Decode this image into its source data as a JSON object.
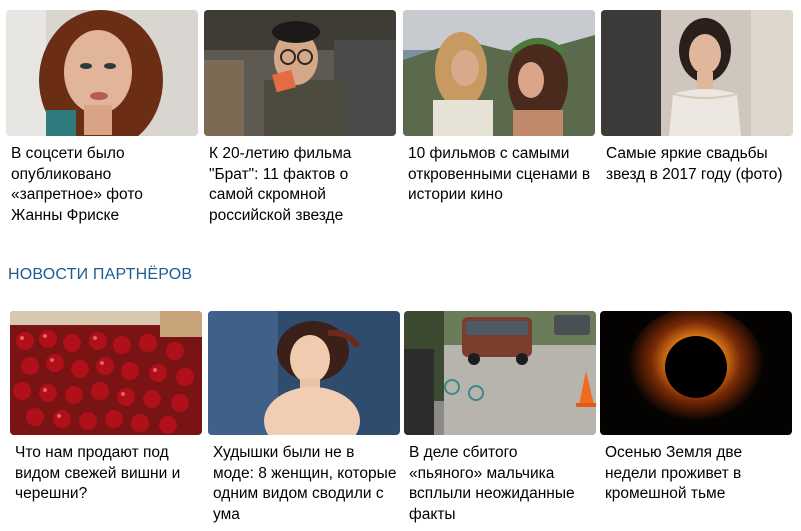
{
  "top_cards": [
    {
      "image": "woman-portrait-photo",
      "caption": "В соцсети было опубликовано «запретное» фото Жанны Фриске"
    },
    {
      "image": "man-with-glasses-photo",
      "caption": "К 20-летию фильма \"Брат\": 11 фактов о самой скромной российской звезде"
    },
    {
      "image": "couple-film-still-photo",
      "caption": "10 фильмов с самыми откровенными сценами в истории кино"
    },
    {
      "image": "bride-photo",
      "caption": "Самые яркие свадьбы звезд в 2017 году (фото)"
    }
  ],
  "partners_title": "НОВОСТИ ПАРТНЁРОВ",
  "bottom_cards": [
    {
      "image": "cherries-photo",
      "caption": "Что нам продают под видом свежей вишни и черешни?"
    },
    {
      "image": "painting-woman-photo",
      "caption": "Худышки были не в моде: 8 женщин, которые одним видом сводили с ума"
    },
    {
      "image": "street-accident-photo",
      "caption": "В деле сбитого «пьяного» мальчика всплыли неожиданные факты"
    },
    {
      "image": "solar-eclipse-photo",
      "caption": "Осенью Земля две недели проживет в кромешной тьме"
    }
  ]
}
